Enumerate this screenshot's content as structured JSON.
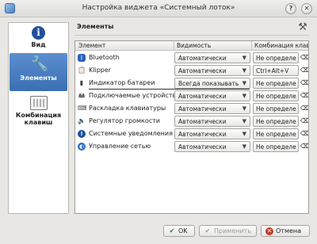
{
  "window": {
    "title": "Настройка виджета «Системный лоток»"
  },
  "sidebar": {
    "items": [
      {
        "label": "Вид",
        "icon": "info-icon"
      },
      {
        "label": "Элементы",
        "icon": "wrench-icon",
        "selected": true
      },
      {
        "label": "Комбинация клавиш",
        "icon": "keyboard-icon"
      }
    ]
  },
  "section": {
    "title": "Элементы"
  },
  "table": {
    "headers": [
      "Элемент",
      "Видимость",
      "Комбинация клав"
    ],
    "rows": [
      {
        "name": "Bluetooth",
        "icon": "bluetooth-icon",
        "visibility": "Автоматически",
        "shortcut": "Не определе"
      },
      {
        "name": "Klipper",
        "icon": "clipboard-icon",
        "visibility": "Автоматически",
        "shortcut": "Ctrl+Alt+V"
      },
      {
        "name": "Индикатор батареи",
        "icon": "battery-icon",
        "visibility": "Всегда показывать",
        "shortcut": "Не определе"
      },
      {
        "name": "Подключаемые устройства",
        "icon": "device-icon",
        "visibility": "Автоматически",
        "shortcut": "Не определе"
      },
      {
        "name": "Раскладка клавиатуры",
        "icon": "keyboard-layout-icon",
        "visibility": "Автоматически",
        "shortcut": "Не определе"
      },
      {
        "name": "Регулятор громкости",
        "icon": "volume-icon",
        "visibility": "Автоматически",
        "shortcut": "Не определе"
      },
      {
        "name": "Системные уведомления",
        "icon": "notification-icon",
        "visibility": "Автоматически",
        "shortcut": "Не определе"
      },
      {
        "name": "Управление сетью",
        "icon": "network-icon",
        "visibility": "Автоматически",
        "shortcut": "Не определе"
      }
    ]
  },
  "buttons": {
    "ok": "OK",
    "apply": "Применить",
    "cancel": "Отмена"
  }
}
